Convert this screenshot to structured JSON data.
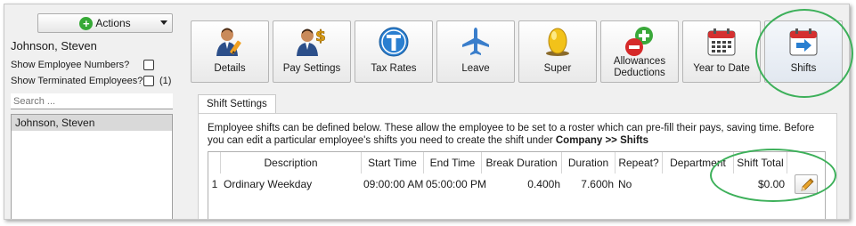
{
  "sidebar": {
    "actions_label": "Actions",
    "employee_name": "Johnson, Steven",
    "show_numbers_label": "Show Employee Numbers?",
    "show_terminated_label": "Show Terminated Employees?",
    "terminated_count": "(1)",
    "search_placeholder": "Search ...",
    "employees": [
      "Johnson, Steven"
    ]
  },
  "toolbar": {
    "buttons": [
      {
        "label": "Details",
        "icon": "person-edit-icon"
      },
      {
        "label": "Pay Settings",
        "icon": "person-dollar-icon"
      },
      {
        "label": "Tax Rates",
        "icon": "tax-t-icon"
      },
      {
        "label": "Leave",
        "icon": "airplane-icon"
      },
      {
        "label": "Super",
        "icon": "golden-egg-icon"
      },
      {
        "label": "Allowances\nDeductions",
        "label_line1": "Allowances",
        "label_line2": "Deductions",
        "icon": "plus-minus-icon"
      },
      {
        "label": "Year to Date",
        "icon": "calendar-icon"
      },
      {
        "label": "Shifts",
        "icon": "calendar-arrow-icon"
      }
    ],
    "active": "Shifts"
  },
  "tab": {
    "label": "Shift Settings"
  },
  "content": {
    "description_prefix": "Employee shifts can be defined below. These allow the employee to be set to a roster which can pre-fill their pays, saving time. Before you can edit a particular employee's shifts you need to create the shift under ",
    "description_bold": "Company >> Shifts"
  },
  "shifts_table": {
    "columns": [
      "Description",
      "Start Time",
      "End Time",
      "Break Duration",
      "Duration",
      "Repeat?",
      "Department",
      "Shift Total"
    ],
    "rows": [
      {
        "num": "1",
        "description": "Ordinary Weekday",
        "start": "09:00:00 AM",
        "end": "05:00:00 PM",
        "break": "0.400h",
        "duration": "7.600h",
        "repeat": "No",
        "department": "",
        "total": "$0.00"
      }
    ]
  },
  "colors": {
    "highlight": "#3db05a",
    "selected_row": "#d9d9d9"
  }
}
